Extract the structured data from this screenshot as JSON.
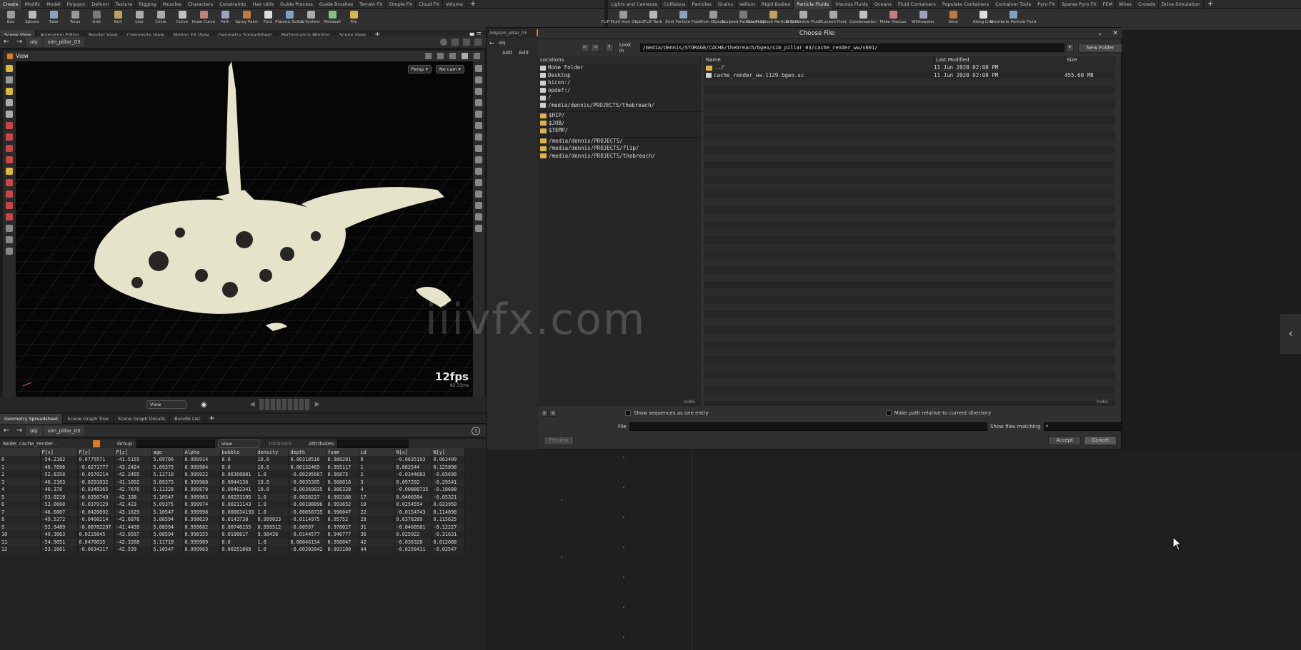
{
  "shelf_left": {
    "tabs": [
      "Create",
      "Modify",
      "Model",
      "Polygon",
      "Deform",
      "Texture",
      "Rigging",
      "Muscles",
      "Characters",
      "Constraints",
      "Hair Utils",
      "Guide Process",
      "Guide Brushes",
      "Terrain FX",
      "Simple FX",
      "Cloud FX",
      "Volume"
    ],
    "active_tab": "Create",
    "tools": [
      "Box",
      "Sphere",
      "Tube",
      "Torus",
      "Grid",
      "Null",
      "Line",
      "Circle",
      "Curve",
      "Draw Curve",
      "Path",
      "Spray Paint",
      "Font",
      "Platonic Solids",
      "L-System",
      "Metaball",
      "File"
    ]
  },
  "shelf_right": {
    "tabs": [
      "Lights and Cameras",
      "Collisions",
      "Particles",
      "Grains",
      "Vellum",
      "Rigid Bodies",
      "Particle Fluids",
      "Viscous Fluids",
      "Oceans",
      "Fluid Containers",
      "Populate Containers",
      "Container Tools",
      "Pyro FX",
      "Sparse Pyro FX",
      "FEM",
      "Wires",
      "Crowds",
      "Drive Simulation"
    ],
    "active_tab": "Particle Fluids",
    "tools": [
      "FLIP Fluid from Object",
      "FLIP Tank",
      "Emit Particle Fluid",
      "from Objects",
      "Sculpted Particle Fluid",
      "Ocean Splash Particle Fluid",
      "Drip Particle Fluid",
      "Tsunami Fluid",
      "Condensation",
      "Make Viscous",
      "Whitewater",
      "Slice",
      "Along Line",
      "Distribute Particle Fluid"
    ]
  },
  "top_panes": {
    "tabs": [
      "Scene View",
      "Animation Editor",
      "Render View",
      "Composite View",
      "Motion FX View",
      "Geometry Spreadsheet",
      "Performance Monitor",
      "Scene View"
    ],
    "path": [
      "obj",
      "sim_pillar_03"
    ]
  },
  "viewport": {
    "title": "View",
    "persp_label": "Persp ▾",
    "cam_label": "No cam ▾",
    "fps": "12fps",
    "fps_sub": "83.33ms"
  },
  "playbar": {
    "view_label": "View"
  },
  "bottom_panes": {
    "tabs": [
      "Geometry Spreadsheet",
      "Scene Graph Tree",
      "Scene Graph Details",
      "Bundle List"
    ],
    "path": [
      "obj",
      "sim_pillar_03"
    ]
  },
  "spreadsheet": {
    "node_label": "Node: cache_render...",
    "group_label": "Group:",
    "view_label": "View",
    "intrinsics_label": "Intrinsics",
    "attributes_label": "Attributes:",
    "columns": [
      "",
      "P[x]",
      "P[y]",
      "P[z]",
      "age",
      "Alpha",
      "bubble",
      "density",
      "depth",
      "foam",
      "id",
      "N[x]",
      "N[y]"
    ],
    "rows": [
      [
        "0",
        "-54.2182",
        "0.0775571",
        "-41.5155",
        "5.09766",
        "0.999914",
        "0.0",
        "10.0",
        "0.00318516",
        "0.988281",
        "0",
        "-0.0635193",
        "0.063409"
      ],
      [
        "1",
        "-46.7696",
        "-0.0271777",
        "-43.2424",
        "5.09375",
        "0.999984",
        "0.0",
        "10.0",
        "0.00132465",
        "0.995117",
        "1",
        "0.082544",
        "0.125898"
      ],
      [
        "2",
        "-52.8358",
        "-0.0570214",
        "-42.3405",
        "5.11719",
        "0.999922",
        "0.00368881",
        "1.0",
        "-0.00295667",
        "0.96875",
        "2",
        "-0.0344683",
        "-0.05698"
      ],
      [
        "3",
        "-48.2163",
        "-0.0291032",
        "-41.1092",
        "5.09375",
        "0.999988",
        "0.0044136",
        "10.0",
        "-0.0035305",
        "0.988016",
        "3",
        "0.097292",
        "-0.29541"
      ],
      [
        "4",
        "-40.378",
        "-0.0340365",
        "-42.7676",
        "5.11328",
        "0.999878",
        "0.00462341",
        "10.0",
        "-0.00369035",
        "0.986328",
        "4",
        "-0.00888735",
        "-0.18688"
      ],
      [
        "5",
        "-53.0219",
        "-0.0356749",
        "-42.338",
        "5.10547",
        "0.999963",
        "0.00253105",
        "1.0",
        "-0.0028237",
        "0.992188",
        "17",
        "0.0406504",
        "-0.05321"
      ],
      [
        "6",
        "-53.0668",
        "-0.0379129",
        "-42.423",
        "5.09375",
        "0.999974",
        "0.00211143",
        "1.0",
        "-0.00188896",
        "0.993652",
        "18",
        "0.0254554",
        "0.023950"
      ],
      [
        "7",
        "-46.6087",
        "-0.0420692",
        "-43.1629",
        "5.10547",
        "0.999998",
        "0.000634193",
        "1.0",
        "-0.00050735",
        "0.998047",
        "22",
        "-0.0154743",
        "0.114098"
      ],
      [
        "8",
        "-49.5372",
        "-0.0460214",
        "-42.6878",
        "5.08594",
        "0.998629",
        "0.0143738",
        "0.999023",
        "-0.0114975",
        "0.95752",
        "28",
        "0.0378289",
        "0.115625"
      ],
      [
        "9",
        "-52.9489",
        "-0.00782297",
        "-41.4439",
        "5.08594",
        "0.999682",
        "0.00746155",
        "0.999512",
        "-0.00597",
        "0.978027",
        "31",
        "-0.0460581",
        "-0.12227"
      ],
      [
        "10",
        "-49.3063",
        "0.0215645",
        "-43.0587",
        "5.08594",
        "0.998155",
        "0.0180817",
        "9.98438",
        "-0.0144577",
        "0.946777",
        "36",
        "0.025922",
        "-0.31631"
      ],
      [
        "11",
        "-54.9051",
        "0.0470035",
        "-42.3268",
        "5.11719",
        "0.999909",
        "0.0",
        "1.0",
        "0.00046134",
        "0.998047",
        "42",
        "-0.036328",
        "0.012088"
      ],
      [
        "12",
        "-53.1601",
        "-0.0634317",
        "-42.539",
        "5.10547",
        "0.999963",
        "0.00251868",
        "1.0",
        "-0.00202042",
        "0.993180",
        "44",
        "-0.0258411",
        "-0.02547"
      ]
    ]
  },
  "dialog": {
    "tab_path": "/obj/sim_pillar_03",
    "tab_node": "sim_pillar_03",
    "side_nav": "obj",
    "add_label": "Add",
    "edit_label": "Edit",
    "title": "Choose File:",
    "look_in_label": "Look in",
    "look_in_value": "/media/dennis/STORAGE/CACHE/thebreach/bgeo/sim_pillar_03/cache_render_ww/v001/",
    "new_folder_label": "New Folder",
    "locations_header": "Locations",
    "locations": [
      {
        "label": "Home Folder",
        "icon": "home-icon"
      },
      {
        "label": "Desktop",
        "icon": "desktop-icon"
      },
      {
        "label": "hicon:/",
        "icon": "drive-icon"
      },
      {
        "label": "opdef:/",
        "icon": "drive-icon"
      },
      {
        "label": "/",
        "icon": "drive-icon"
      },
      {
        "label": "/media/dennis/PROJECTS/thebreach/",
        "icon": "drive-icon"
      }
    ],
    "vars": [
      "$HIP/",
      "$JOB/",
      "$TEMP/"
    ],
    "recent": [
      "/media/dennis/PROJECTS/",
      "/media/dennis/PROJECTS/flip/",
      "/media/dennis/PROJECTS/thebreach/"
    ],
    "locations_footer": "Indie",
    "files_header": {
      "name": "Name",
      "modified": "Last Modified",
      "size": "Size"
    },
    "files": [
      {
        "name": "../",
        "modified": "11 Jun 2020 02:08 PM",
        "size": ""
      },
      {
        "name": "cache_render_ww.1129.bgeo.sc",
        "modified": "11 Jun 2020 02:08 PM",
        "size": "455.60 MB"
      }
    ],
    "files_footer": "Indie",
    "show_sequences_label": "Show sequences as one entry",
    "relative_label": "Make path relative to current directory",
    "file_label": "File",
    "file_value": "",
    "show_matching_label": "Show files matching",
    "matching_value": "*",
    "preview_label": "Preview",
    "accept_label": "Accept",
    "cancel_label": "Cancel"
  },
  "watermark": "iiivfx.com",
  "colors": {
    "accent_orange": "#f07c1e",
    "folder_yellow": "#d8b44a",
    "fluid_cream": "#e6e3cb",
    "background": "#1c1c1c"
  }
}
